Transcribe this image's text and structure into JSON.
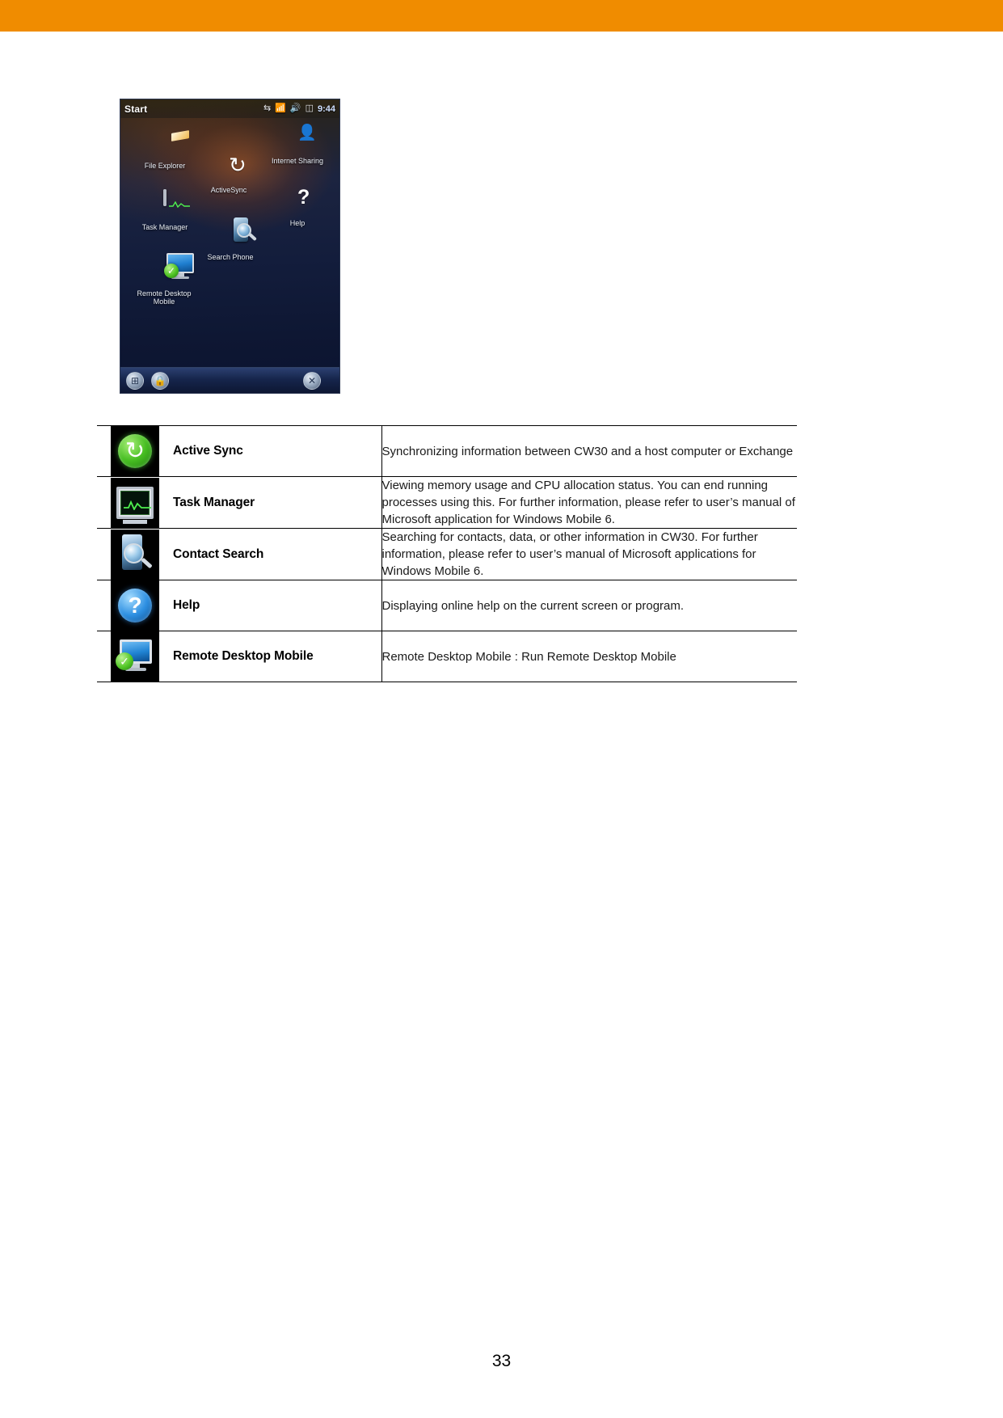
{
  "page": {
    "number": "33",
    "banner_color": "#F08C00",
    "background_color": "#FFFFFF"
  },
  "device_screenshot": {
    "title": "Start",
    "status_bar": {
      "icons": [
        "connectivity-icon",
        "signal-icon",
        "volume-icon",
        "battery-icon"
      ],
      "clock": "9:44"
    },
    "icons": [
      {
        "label": "File Explorer",
        "icon": "folder-icon"
      },
      {
        "label": "Internet Sharing",
        "icon": "internet-sharing-icon"
      },
      {
        "label": "ActiveSync",
        "icon": "activesync-icon"
      },
      {
        "label": "Task Manager",
        "icon": "task-manager-icon"
      },
      {
        "label": "Help",
        "icon": "help-icon"
      },
      {
        "label": "Search Phone",
        "icon": "search-phone-icon"
      },
      {
        "label": "Remote Desktop Mobile",
        "icon": "remote-desktop-icon"
      }
    ],
    "taskbar": {
      "start_button": "windows-start-icon",
      "lock_button": "lock-icon",
      "close_button": "close-icon"
    }
  },
  "table": {
    "rows": [
      {
        "icon": "activesync-icon",
        "name": "Active Sync",
        "description": "Synchronizing information between CW30 and a host computer or Exchange"
      },
      {
        "icon": "task-manager-icon",
        "name": "Task Manager",
        "description": "Viewing memory usage and CPU allocation status. You can end running processes using this. For further information, please refer to user’s manual of Microsoft application for Windows Mobile 6."
      },
      {
        "icon": "contact-search-icon",
        "name": "Contact Search",
        "description": "Searching for contacts, data, or other information in CW30. For further information, please refer to user’s manual of Microsoft applications for Windows Mobile 6."
      },
      {
        "icon": "help-icon",
        "name": "Help",
        "description": "Displaying online help on the current screen or program."
      },
      {
        "icon": "remote-desktop-icon",
        "name": "Remote Desktop Mobile",
        "description": "Remote Desktop Mobile : Run Remote Desktop Mobile"
      }
    ]
  }
}
